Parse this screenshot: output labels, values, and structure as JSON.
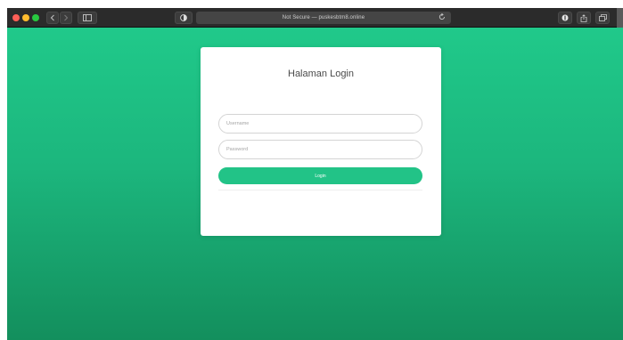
{
  "browser": {
    "address_text": "Not Secure — puskesbtm8.online"
  },
  "login": {
    "title": "Halaman Login",
    "username_placeholder": "Username",
    "password_placeholder": "Password",
    "button_label": "Login"
  },
  "colors": {
    "accent": "#22c387",
    "background_top": "#20c98a",
    "background_bottom": "#138f5d"
  }
}
